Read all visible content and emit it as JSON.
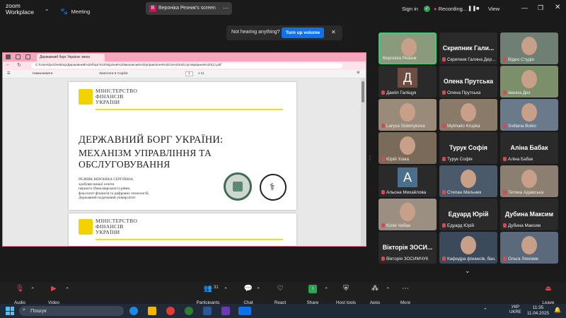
{
  "zoom": {
    "logo_line1": "zoom",
    "logo_line2": "Workplace"
  },
  "topbar": {
    "meeting_label": "Meeting",
    "screen_owner_initial": "В",
    "screen_label": "Вероніка Резник's screen",
    "signin": "Sign in",
    "recording": "Recording...",
    "view": "View"
  },
  "notification": {
    "text": "Not hearing anything?",
    "button": "Turn up volume"
  },
  "browser": {
    "tab_title": "Державний борг України: меха",
    "url": "C:/Users/pc/Desktop/Державний%20борг%20України%20механізм%20управління%20та%20обслуговування%20(1).pdf",
    "pdf_draw": "Намалювати",
    "pdf_ask": "Запитати в Copilot",
    "pdf_page": "1",
    "pdf_total": "з 11"
  },
  "slide": {
    "ministry_line1": "МІНІСТЕРСТВО",
    "ministry_line2": "ФІНАНСІВ",
    "ministry_line3": "УКРАЇНИ",
    "title_line1": "ДЕРЖАВНИЙ БОРГ УКРАЇНИ:",
    "title_line2": "МЕХАНІЗМ УПРАВЛІННЯ ТА ОБСЛУГОВУВАННЯ",
    "author_lines": [
      "РЕЗНИК ВЕРОНІКА СЕРГІЇВНА,",
      "здобувач вищої освіти",
      "першого (бакалаврського) рівня,",
      "факультет фінансів та цифрових технологій,",
      "Державний податковий університет"
    ]
  },
  "participants": [
    {
      "name": "Вероніка Резник",
      "big": "",
      "muted": false,
      "kind": "video"
    },
    {
      "name": "Скрипник Галина Дер...",
      "big": "Скрипник Гали...",
      "muted": true,
      "kind": "name"
    },
    {
      "name": "Відео Студія",
      "big": "",
      "muted": true,
      "kind": "video"
    },
    {
      "name": "Данііл Галіщук",
      "big": "",
      "muted": true,
      "kind": "letter",
      "letter": "Д"
    },
    {
      "name": "Олена Прутська",
      "big": "Олена Прутська",
      "muted": true,
      "kind": "name"
    },
    {
      "name": "Іванна Дюг",
      "big": "",
      "muted": true,
      "kind": "video"
    },
    {
      "name": "Larysa Sidelnykova",
      "big": "",
      "muted": true,
      "kind": "video"
    },
    {
      "name": "Mykhailo Krupka",
      "big": "",
      "muted": true,
      "kind": "video"
    },
    {
      "name": "Svitlana Boiko",
      "big": "",
      "muted": true,
      "kind": "video"
    },
    {
      "name": "Юрій Хома",
      "big": "",
      "muted": true,
      "kind": "video"
    },
    {
      "name": "Турук Софія",
      "big": "Турук Софія",
      "muted": true,
      "kind": "name"
    },
    {
      "name": "Аліна Бабак",
      "big": "Аліна Бабак",
      "muted": true,
      "kind": "name"
    },
    {
      "name": "Альона Михайлова",
      "big": "",
      "muted": true,
      "kind": "letter",
      "letter": "А"
    },
    {
      "name": "Степан Мельник",
      "big": "",
      "muted": true,
      "kind": "video"
    },
    {
      "name": "Тетяна Адамська",
      "big": "",
      "muted": true,
      "kind": "video"
    },
    {
      "name": "Юлія Чебан",
      "big": "",
      "muted": true,
      "kind": "video"
    },
    {
      "name": "Едуард Юрій",
      "big": "Едуард Юрій",
      "muted": true,
      "kind": "name"
    },
    {
      "name": "Дубина Максим",
      "big": "Дубина Максим",
      "muted": true,
      "kind": "name"
    },
    {
      "name": "Вікторія ЗОСИМЧУК",
      "big": "Вікторія ЗОСИ...",
      "muted": true,
      "kind": "name"
    },
    {
      "name": "Кафедра фінансів, бан...",
      "big": "",
      "muted": true,
      "kind": "video"
    },
    {
      "name": "Ольга Ляховик",
      "big": "",
      "muted": true,
      "kind": "video"
    }
  ],
  "controls": {
    "audio": "Audio",
    "video": "Video",
    "participants": "Participants",
    "participants_count": "31",
    "chat": "Chat",
    "react": "React",
    "share": "Share",
    "host_tools": "Host tools",
    "apps": "Apps",
    "more": "More",
    "leave": "Leave"
  },
  "taskbar": {
    "search": "Пошук",
    "lang_line1": "УКР",
    "lang_line2": "UKRE",
    "time": "11:35",
    "date": "11.04.2025"
  },
  "colors": {
    "accent": "#0e72ed",
    "active_speaker": "#2bd47a",
    "share_green": "#2da44e",
    "muted_red": "#e0464e",
    "share_border": "#e87a9a"
  }
}
